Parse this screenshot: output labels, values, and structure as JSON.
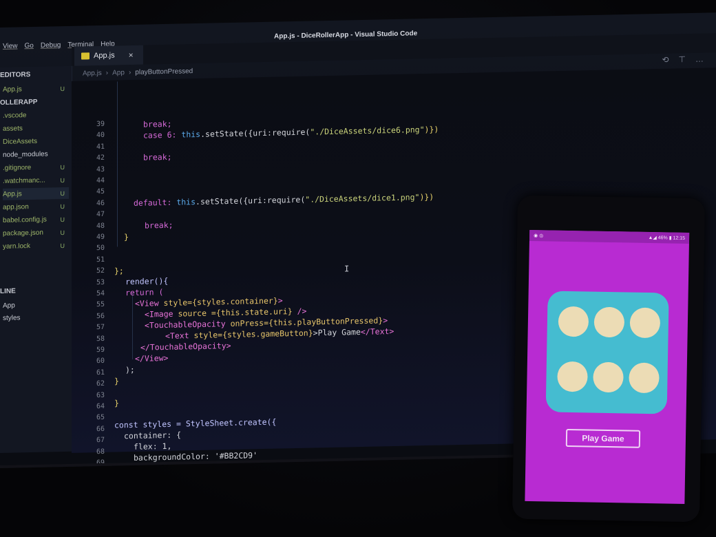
{
  "window": {
    "title": "App.js - DiceRollerApp - Visual Studio Code",
    "menu": [
      "View",
      "Go",
      "Debug",
      "Terminal",
      "Help"
    ]
  },
  "sidebar": {
    "sections": [
      "EDITORS",
      "OLLERAPP",
      "LINE"
    ],
    "items": [
      {
        "name": "App.js",
        "status": "U"
      },
      {
        "name": ".vscode",
        "status": ""
      },
      {
        "name": "assets",
        "status": ""
      },
      {
        "name": "DiceAssets",
        "status": ""
      },
      {
        "name": "node_modules",
        "status": ""
      },
      {
        "name": ".gitignore",
        "status": "U"
      },
      {
        "name": ".watchmanc...",
        "status": "U"
      },
      {
        "name": "App.js",
        "status": "U"
      },
      {
        "name": "app.json",
        "status": "U"
      },
      {
        "name": "babel.config.js",
        "status": "U"
      },
      {
        "name": "package.json",
        "status": "U"
      },
      {
        "name": "yarn.lock",
        "status": "U"
      }
    ],
    "outline": [
      "App",
      "styles"
    ]
  },
  "tab": {
    "label": "App.js",
    "close": "×"
  },
  "breadcrumb": [
    "App.js",
    "App",
    "playButtonPressed"
  ],
  "line_numbers": [
    "39",
    "40",
    "41",
    "42",
    "43",
    "44",
    "45",
    "46",
    "47",
    "48",
    "49",
    "50",
    "51",
    "52",
    "53",
    "54",
    "55",
    "56",
    "57",
    "58",
    "59",
    "60",
    "61",
    "62",
    "63",
    "64",
    "65",
    "66",
    "67",
    "68",
    "69"
  ],
  "code": {
    "l39": "break;",
    "l40a": "case 6: ",
    "l40b": "this",
    "l40c": ".setState({uri:require(",
    "l40d": "\"./DiceAssets/dice6.png\"",
    "l40e": ")})",
    "l42": "break;",
    "l46a": "default: ",
    "l46b": "this",
    "l46c": ".setState({uri:require(",
    "l46d": "\"./DiceAssets/dice1.png\"",
    "l46e": ")})",
    "l48": "break;",
    "l49": "}",
    "l52": "};",
    "l53": "render(){",
    "l54": "return (",
    "l55a": "<View ",
    "l55b": "style={styles.container}",
    "l55c": ">",
    "l56a": "<Image ",
    "l56b": "source ={this.state.uri}",
    "l56c": " />",
    "l57a": "<TouchableOpacity ",
    "l57b": "onPress={this.playButtonPressed}",
    "l57c": ">",
    "l58a": "<Text ",
    "l58b": "style={styles.gameButton}",
    "l58c": ">Play Game",
    "l58d": "</Text>",
    "l59": "</TouchableOpacity>",
    "l60": "</View>",
    "l61": ");",
    "l62": "}",
    "l64": "}",
    "l66": "const styles = StyleSheet.create({",
    "l67": "container: {",
    "l68": "flex: 1,",
    "l69": "backgroundColor: '#BB2CD9'"
  },
  "phone": {
    "status_time": "12:15",
    "battery": "46%",
    "button_label": "Play Game",
    "die_value": 6,
    "colors": {
      "background": "#BB2CD9",
      "die": "#45BCD0",
      "pip": "#ECDCB5"
    }
  }
}
